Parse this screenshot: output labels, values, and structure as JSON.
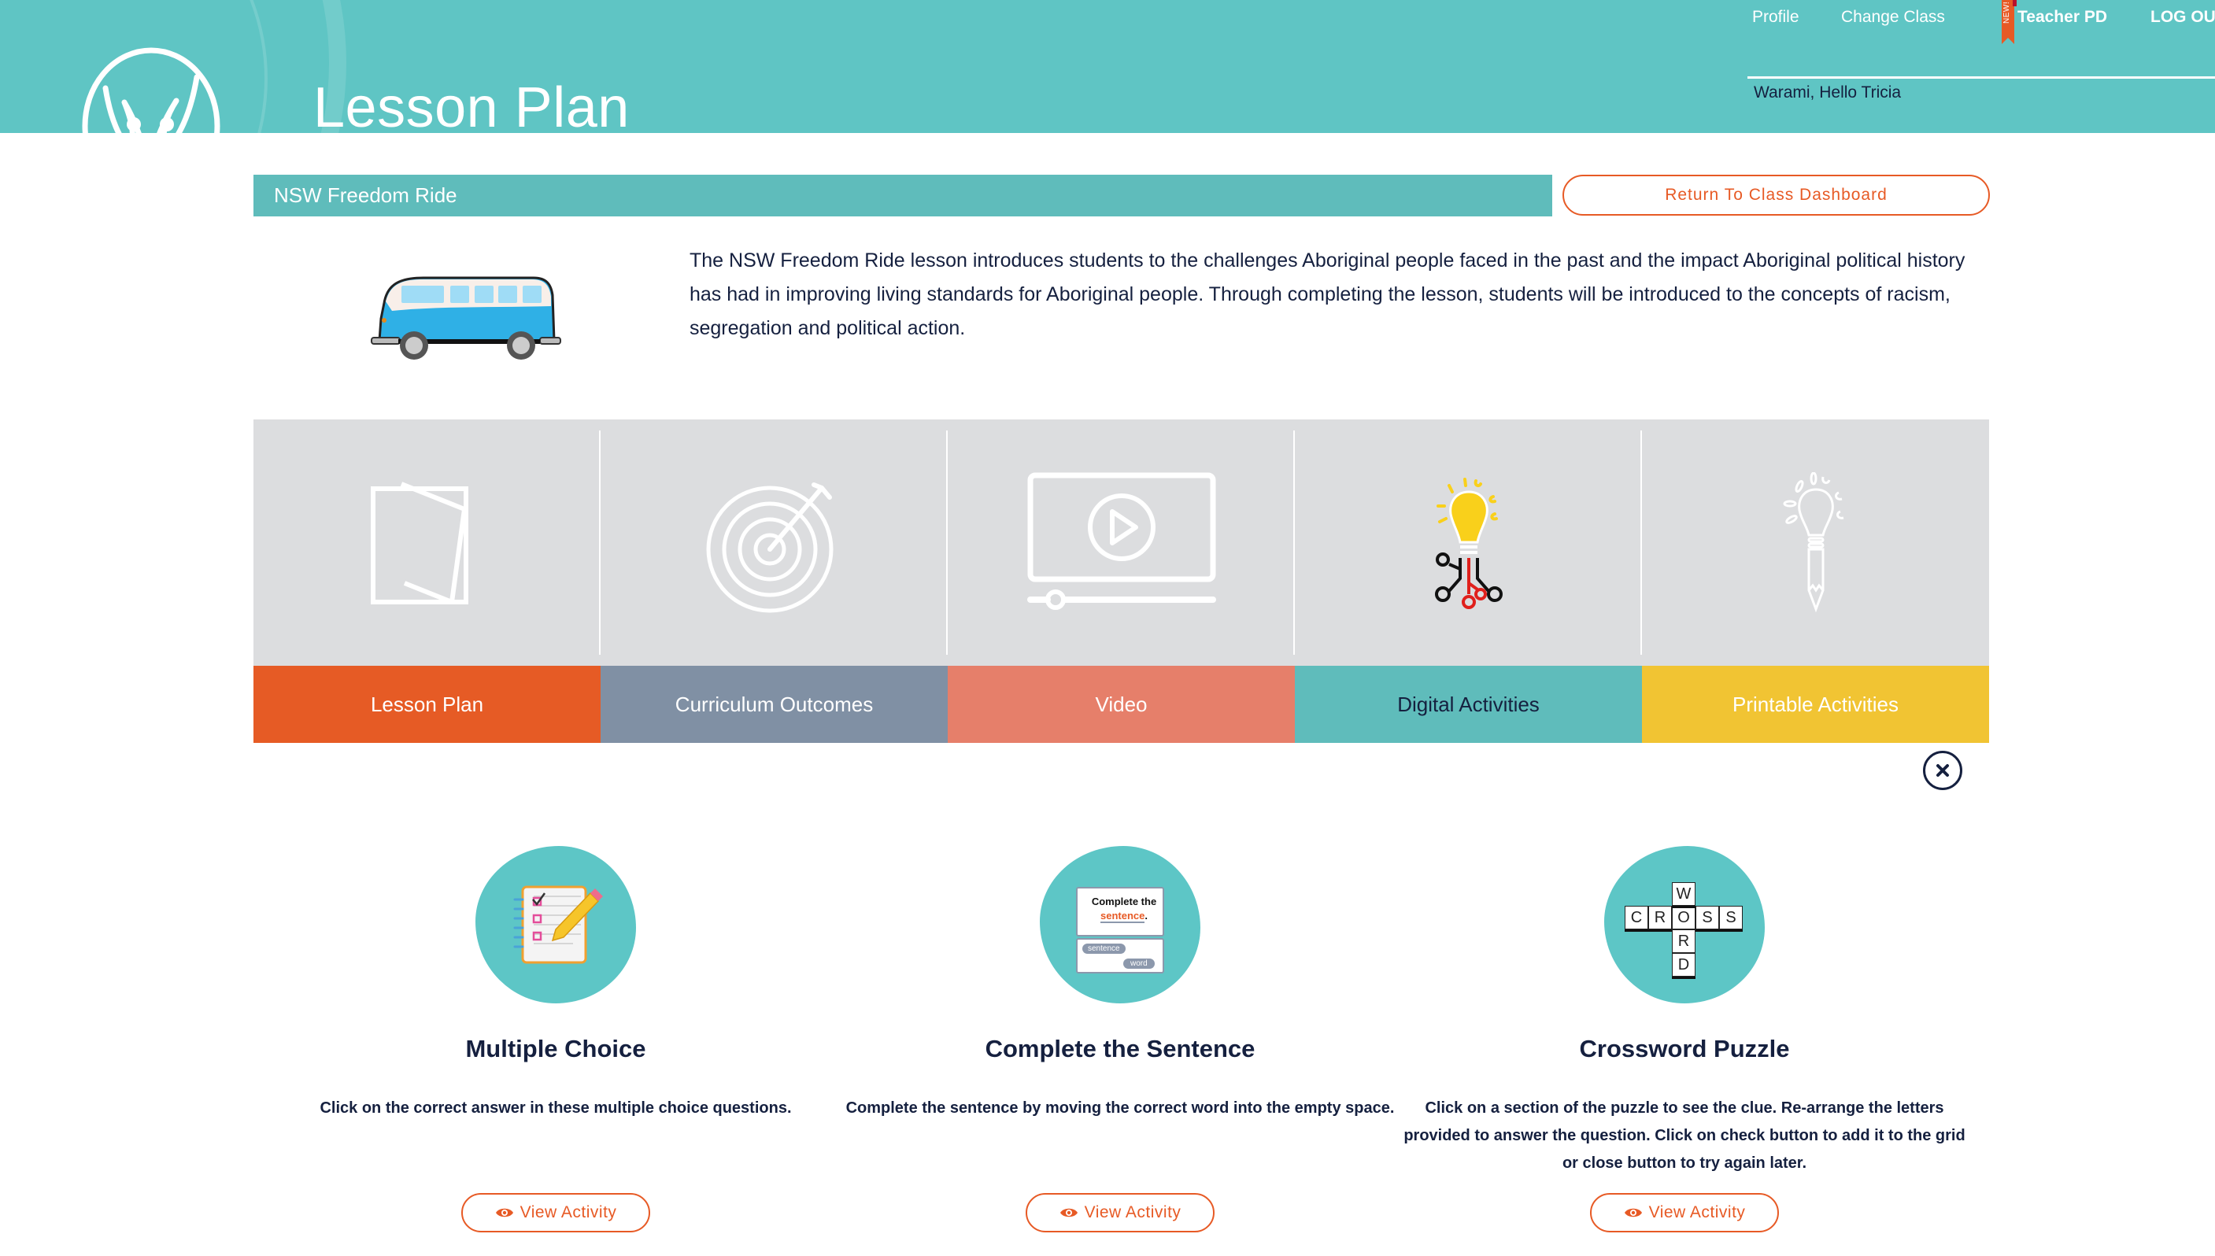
{
  "header": {
    "title": "Lesson Plan",
    "logo_icon": "warami-logo-icon",
    "nav": [
      {
        "label": "Profile"
      },
      {
        "label": "Change Class"
      },
      {
        "label": "Teacher PD",
        "badge": "NEW!"
      },
      {
        "label": "LOG OUT"
      }
    ],
    "greeting": "Warami, Hello Tricia"
  },
  "lesson": {
    "title": "NSW Freedom Ride",
    "return_label": "Return To Class Dashboard",
    "image_icon": "kombi-van-icon",
    "description": "The NSW Freedom Ride lesson introduces students to the challenges Aboriginal people faced in the past and the impact Aboriginal political history has had in improving living standards for Aboriginal people. Through completing the lesson, students will be introduced to the concepts of racism, segregation and political action."
  },
  "categories": [
    {
      "label": "Lesson Plan",
      "icon": "papers-icon",
      "color": "#e65b25",
      "text_color": "#ffffff"
    },
    {
      "label": "Curriculum Outcomes",
      "icon": "target-icon",
      "color": "#8090a4",
      "text_color": "#ffffff"
    },
    {
      "label": "Video",
      "icon": "video-player-icon",
      "color": "#e67f6a",
      "text_color": "#ffffff"
    },
    {
      "label": "Digital Activities",
      "icon": "lightbulb-circuit-icon",
      "color": "#5fbcbb",
      "text_color": "#15203f",
      "active": true
    },
    {
      "label": "Printable Activities",
      "icon": "lightbulb-pencil-icon",
      "color": "#f1c433",
      "text_color": "#ffffff"
    }
  ],
  "close_icon": "close-icon",
  "activities": [
    {
      "title": "Multiple Choice",
      "icon": "checklist-pencil-icon",
      "description": "Click on the correct answer in these multiple choice questions.",
      "button": "View Activity"
    },
    {
      "title": "Complete the Sentence",
      "icon": "complete-sentence-icon",
      "icon_text": {
        "line1": "Complete the",
        "highlight": "sentence",
        "chip1": "sentence",
        "chip2": "word"
      },
      "description": "Complete the sentence by moving the correct word into the empty space.",
      "button": "View Activity"
    },
    {
      "title": "Crossword Puzzle",
      "icon": "crossword-icon",
      "icon_text": {
        "across": "CROSS",
        "down": "WORD"
      },
      "description": "Click on a section of the puzzle to see the clue. Re-arrange the letters provided to answer the question. Click on check button to add it to the grid or close button to try again later.",
      "button": "View Activity"
    }
  ],
  "colors": {
    "brand_teal": "#5fc5c4",
    "accent_orange": "#e75a25",
    "navy_text": "#15203f"
  }
}
